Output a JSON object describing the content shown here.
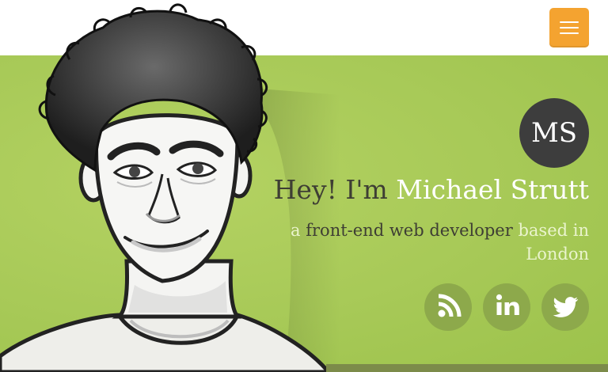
{
  "header": {
    "menu_icon": "hamburger-menu-icon",
    "menu_color": "#f4a330"
  },
  "hero": {
    "background_color": "#a7c957",
    "badge": {
      "initials": "MS"
    },
    "greeting": {
      "prefix": "Hey! I'm",
      "name": "Michael Strutt"
    },
    "tagline": {
      "lead": "a",
      "role": "front-end web developer",
      "tail": "based in London"
    },
    "social": [
      {
        "icon": "rss-icon"
      },
      {
        "icon": "linkedin-icon"
      },
      {
        "icon": "twitter-icon"
      }
    ]
  }
}
